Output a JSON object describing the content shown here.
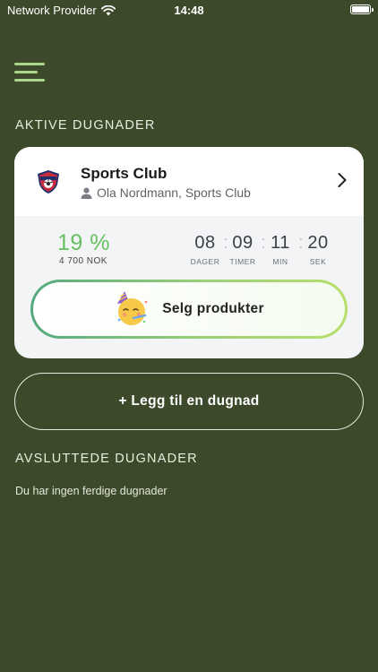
{
  "status_bar": {
    "carrier": "Network Provider",
    "time": "14:48"
  },
  "sections": {
    "active_title": "AKTIVE DUGNADER",
    "finished_title": "AVSLUTTEDE DUGNADER",
    "finished_empty": "Du har ingen ferdige dugnader"
  },
  "card": {
    "club_name": "Sports Club",
    "subtitle": "Ola Nordmann, Sports Club",
    "progress_percent_text": "19 %",
    "progress_value": 19,
    "amount": "4 700 NOK",
    "countdown": {
      "days": "08",
      "hours": "09",
      "minutes": "11",
      "seconds": "20",
      "separator": ":",
      "days_label": "DAGER",
      "hours_label": "TIMER",
      "minutes_label": "MIN",
      "seconds_label": "SEK"
    },
    "sell_button_label": "Selg produkter",
    "sell_button_emoji": "🥳"
  },
  "add_button_label": "+ Legg til en dugnad",
  "icons": {
    "menu": "hamburger-menu-icon",
    "wifi": "wifi-icon",
    "battery": "battery-icon",
    "user": "user-icon",
    "chevron": "chevron-right-icon",
    "club_logo": "club-logo",
    "party": "party-face-icon"
  },
  "colors": {
    "background": "#3c4a2b",
    "accent_green": "#66c160",
    "menu_green": "#a9d88a",
    "card_bg": "#f3f4f6"
  }
}
